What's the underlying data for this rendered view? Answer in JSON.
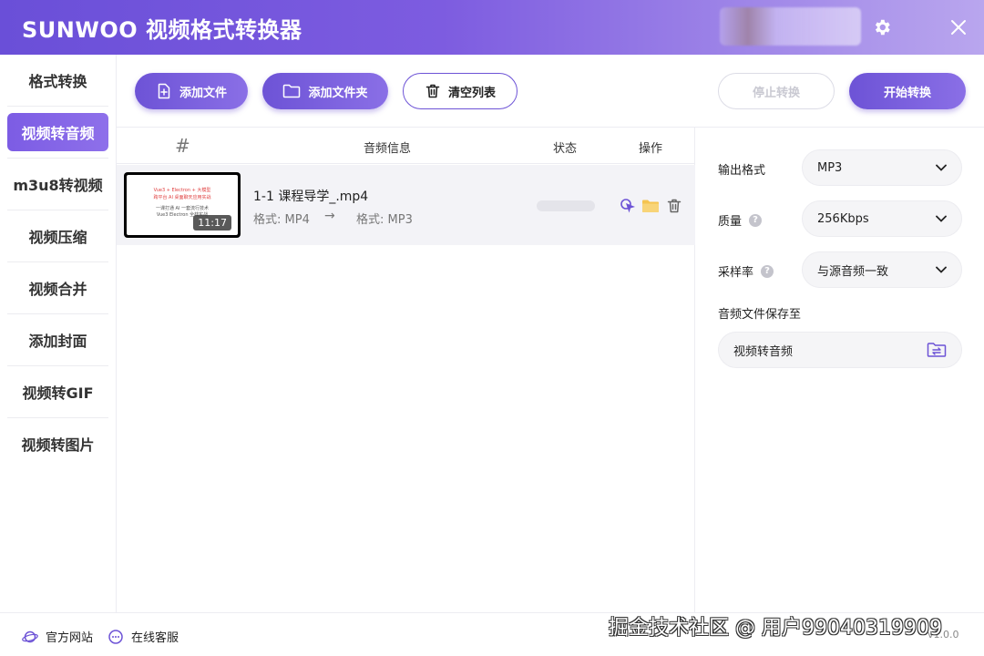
{
  "app": {
    "title": "SUNWOO 视频格式转换器"
  },
  "sidebar": {
    "items": [
      {
        "label": "格式转换",
        "active": false
      },
      {
        "label": "视频转音频",
        "active": true
      },
      {
        "label": "m3u8转视频",
        "active": false
      },
      {
        "label": "视频压缩",
        "active": false
      },
      {
        "label": "视频合并",
        "active": false
      },
      {
        "label": "添加封面",
        "active": false
      },
      {
        "label": "视频转GIF",
        "active": false
      },
      {
        "label": "视频转图片",
        "active": false
      }
    ]
  },
  "toolbar": {
    "add_file": "添加文件",
    "add_folder": "添加文件夹",
    "clear_list": "清空列表",
    "stop": "停止转换",
    "start": "开始转换"
  },
  "table": {
    "headers": {
      "index": "#",
      "info": "音频信息",
      "status": "状态",
      "actions": "操作"
    },
    "rows": [
      {
        "filename": "1-1 课程导学_.mp4",
        "source_format": "格式: MP4",
        "target_format": "格式: MP3",
        "arrow": "→",
        "duration": "11:17",
        "thumb_lines": [
          "Vue3 + Electron + 大模型",
          "跨平台 AI 桌面聊天应用实战",
          "一课打通 AI 一套流行技术",
          "Vue3 Electron 全栈实战"
        ]
      }
    ]
  },
  "settings": {
    "output_format": {
      "label": "输出格式",
      "value": "MP3"
    },
    "quality": {
      "label": "质量",
      "value": "256Kbps"
    },
    "sample_rate": {
      "label": "采样率",
      "value": "与源音频一致"
    },
    "save_to": {
      "label": "音频文件保存至",
      "value": "视频转音频"
    }
  },
  "footer": {
    "website": "官方网站",
    "support": "在线客服",
    "version": "v1.0.0"
  },
  "watermark": "掘金技术社区 @ 用户99040319909",
  "colors": {
    "accent": "#6d53d6",
    "accent_light": "#8a6fe6",
    "folder": "#f5c451"
  }
}
